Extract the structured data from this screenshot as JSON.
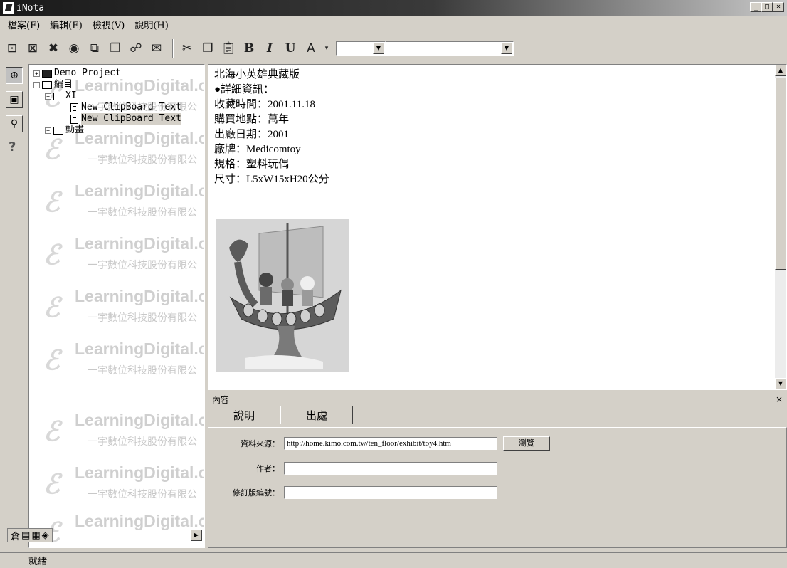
{
  "window": {
    "title": "iNota",
    "controls": [
      "_",
      "□",
      "×"
    ]
  },
  "menu": [
    "檔案(F)",
    "編輯(E)",
    "檢視(V)",
    "說明(H)"
  ],
  "toolbar": {
    "icons": [
      "new-note-icon",
      "new-folder-icon",
      "delete-icon",
      "properties-icon",
      "copy-page-icon",
      "paste-page-icon",
      "capture-icon",
      "mail-icon"
    ],
    "format": [
      "cut-icon",
      "copy-icon",
      "paste-icon",
      "B",
      "I",
      "U",
      "A"
    ],
    "font_combo": "",
    "size_combo": ""
  },
  "left_strip": [
    "tree-view-icon",
    "layout-icon",
    "search-icon",
    "?"
  ],
  "tree": {
    "items": [
      {
        "label": "Demo Project"
      },
      {
        "label": "編目"
      },
      {
        "label": "XI"
      },
      {
        "label": "New ClipBoard Text"
      },
      {
        "label": "New ClipBoard Text"
      },
      {
        "label": "動畫"
      }
    ],
    "watermark_text": "LearningDigital.c",
    "watermark_sub": "一宇數位科技股份有限公"
  },
  "tree_bottom_tabs": [
    "倉",
    "▤",
    "▦",
    "◈"
  ],
  "content": {
    "lines": [
      "北海小英雄典藏版",
      "●詳細資訊：",
      "收藏時間：2001.11.18",
      "購買地點：萬年",
      "出廠日期：2001",
      "廠牌：Medicomtoy",
      "規格：塑料玩偶",
      "尺寸：L5xW15xH20公分"
    ]
  },
  "properties": {
    "header": "內容",
    "close": "×",
    "tabs": [
      "說明",
      "出處"
    ],
    "active_tab": "出處",
    "fields": {
      "source_label": "資料來源：",
      "source_value": "http://home.kimo.com.tw/ten_floor/exhibit/toy4.htm",
      "browse_label": "瀏覽",
      "author_label": "作者：",
      "author_value": "",
      "revision_label": "修訂版編號：",
      "revision_value": ""
    }
  },
  "status": "就緒"
}
